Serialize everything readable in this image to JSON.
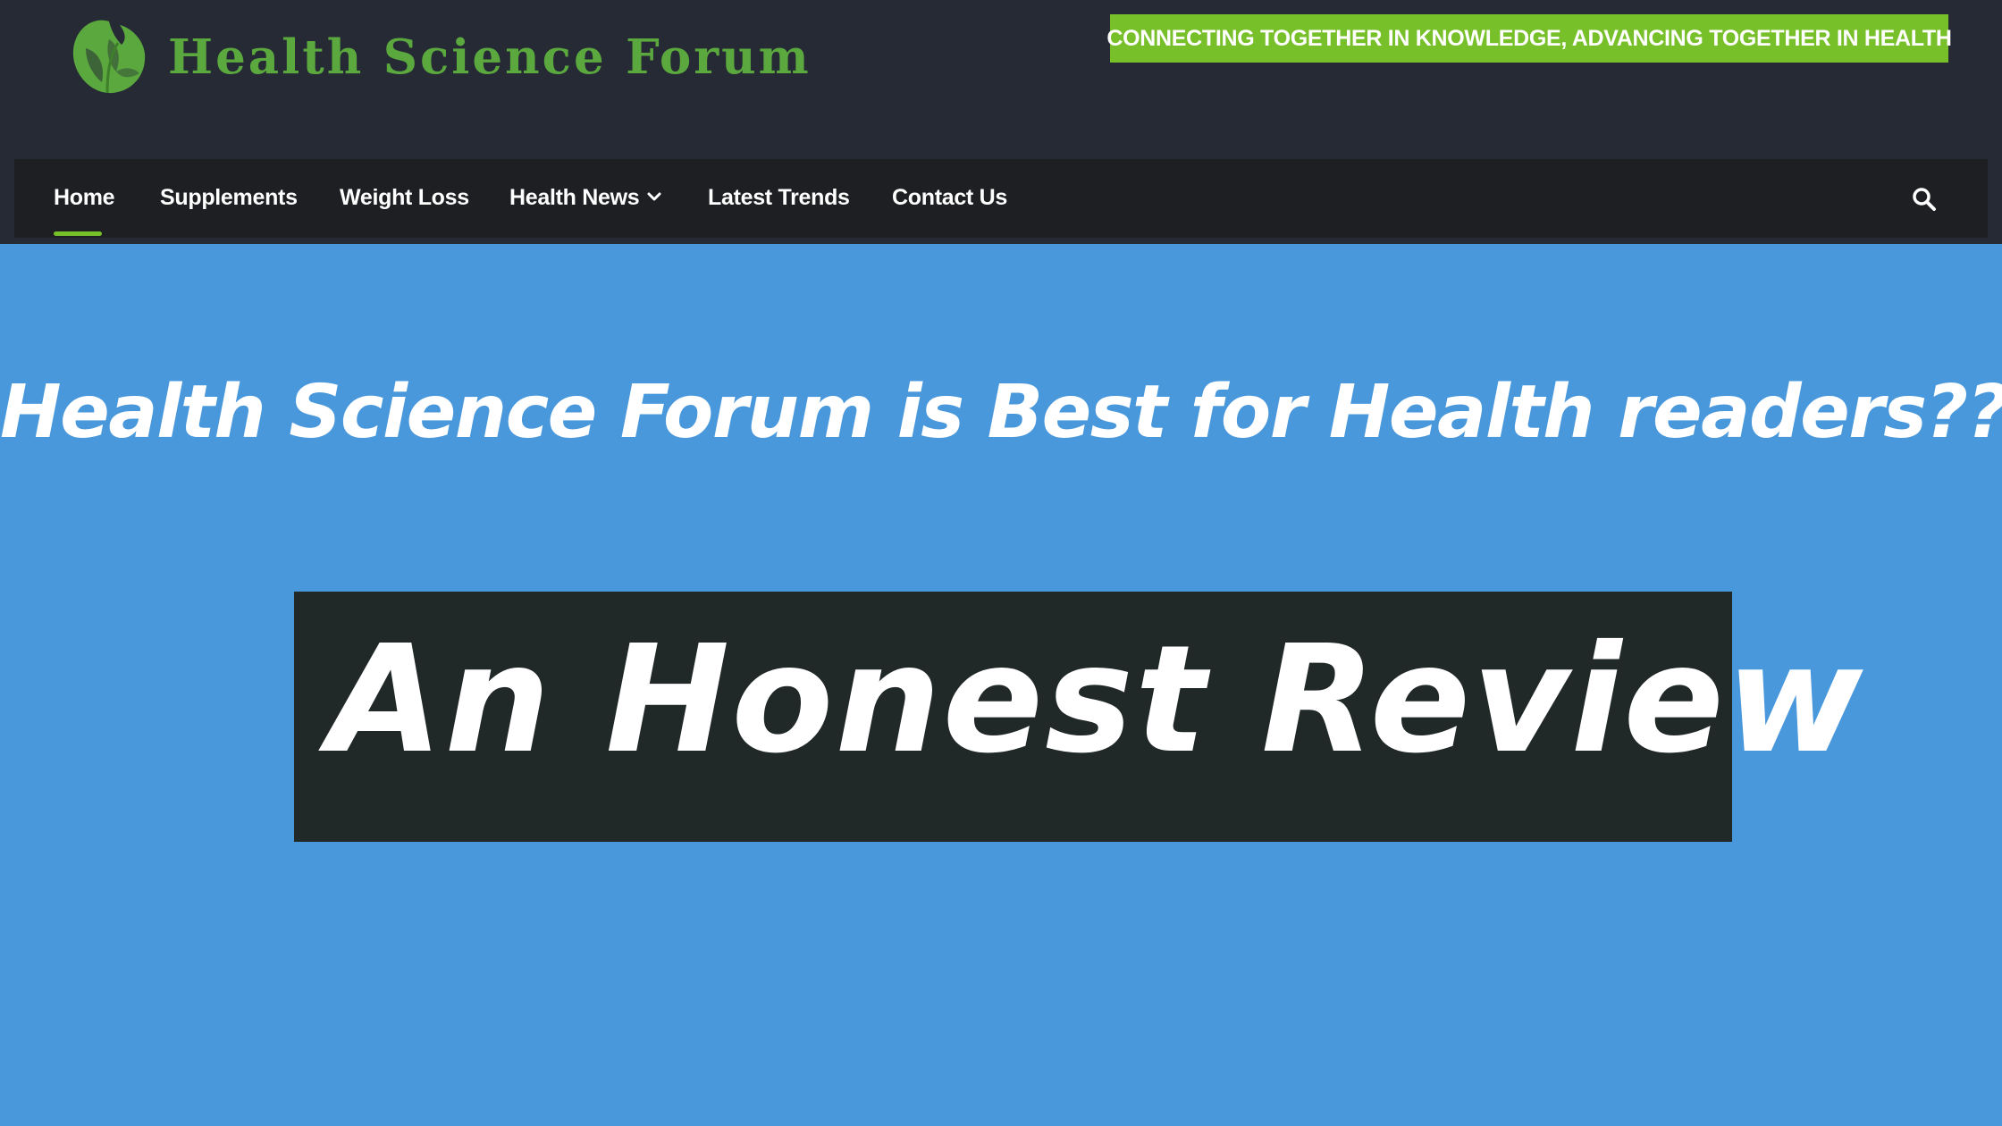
{
  "header": {
    "logo_text": "Health Science Forum",
    "tagline": "CONNECTING TOGETHER IN KNOWLEDGE, ADVANCING TOGETHER IN HEALTH",
    "logo_icon": "leaf-logo-icon"
  },
  "nav": {
    "items": [
      {
        "label": "Home",
        "active": true
      },
      {
        "label": "Supplements"
      },
      {
        "label": "Weight Loss"
      },
      {
        "label": "Health News",
        "has_dropdown": true
      },
      {
        "label": "Latest Trends"
      },
      {
        "label": "Contact Us"
      }
    ],
    "search_icon": "search-icon"
  },
  "hero": {
    "headline": "Health Science Forum is Best for Health readers??",
    "review_label": "An Honest Review"
  },
  "colors": {
    "background": "#4a98dc",
    "header": "#262a35",
    "navbar": "#1e1f22",
    "accent": "#78c02a",
    "logo": "#5aa83e",
    "review_box": "#212828"
  }
}
